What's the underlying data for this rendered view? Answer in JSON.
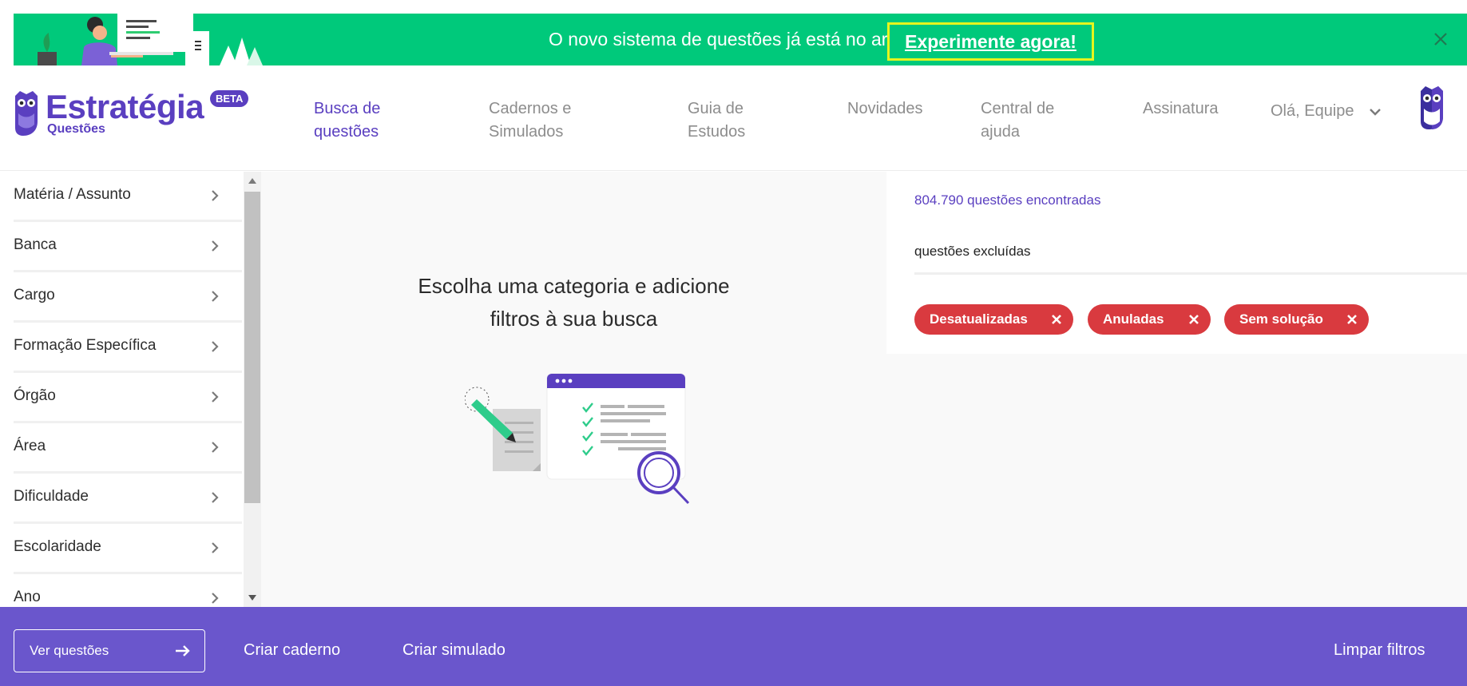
{
  "banner": {
    "message": "O novo sistema de questões já está no ar",
    "cta": "Experimente agora!",
    "color": "#00c97b"
  },
  "header": {
    "logo_title": "Estratégia",
    "logo_subtitle": "Questões",
    "beta_badge": "BETA",
    "nav": [
      {
        "line1": "Busca de",
        "line2": "questões"
      },
      {
        "line1": "Cadernos e",
        "line2": "Simulados"
      },
      {
        "line1": "Guia de",
        "line2": "Estudos"
      },
      {
        "line1": "Novidades",
        "line2": ""
      },
      {
        "line1": "Central de",
        "line2": "ajuda"
      },
      {
        "line1": "Assinatura",
        "line2": ""
      }
    ],
    "greeting": "Olá, Equipe",
    "brand_color": "#5a3fc0"
  },
  "sidebar": {
    "filters": [
      {
        "label": "Matéria / Assunto"
      },
      {
        "label": "Banca"
      },
      {
        "label": "Cargo"
      },
      {
        "label": "Formação Específica"
      },
      {
        "label": "Órgão"
      },
      {
        "label": "Área"
      },
      {
        "label": "Dificuldade"
      },
      {
        "label": "Escolaridade"
      },
      {
        "label": "Ano"
      }
    ]
  },
  "center": {
    "heading_line1": "Escolha uma categoria e adicione",
    "heading_line2": "filtros à sua busca"
  },
  "results": {
    "count_text": "804.790 questões encontradas",
    "excluded_title": "questões excluídas",
    "chips": [
      {
        "label": "Desatualizadas"
      },
      {
        "label": "Anuladas"
      },
      {
        "label": "Sem solução"
      }
    ],
    "chip_color": "#d93a3f"
  },
  "footer": {
    "ver_questoes": "Ver questões",
    "criar_caderno": "Criar caderno",
    "criar_simulado": "Criar simulado",
    "limpar_filtros": "Limpar filtros",
    "color": "#6a56cc"
  },
  "icons": {
    "banner_close": "close-icon",
    "nav_chevron": "chevron-down-icon",
    "filter_chevron": "chevron-right-icon",
    "chip_remove": "close-icon",
    "footer_arrow": "arrow-right-icon"
  }
}
